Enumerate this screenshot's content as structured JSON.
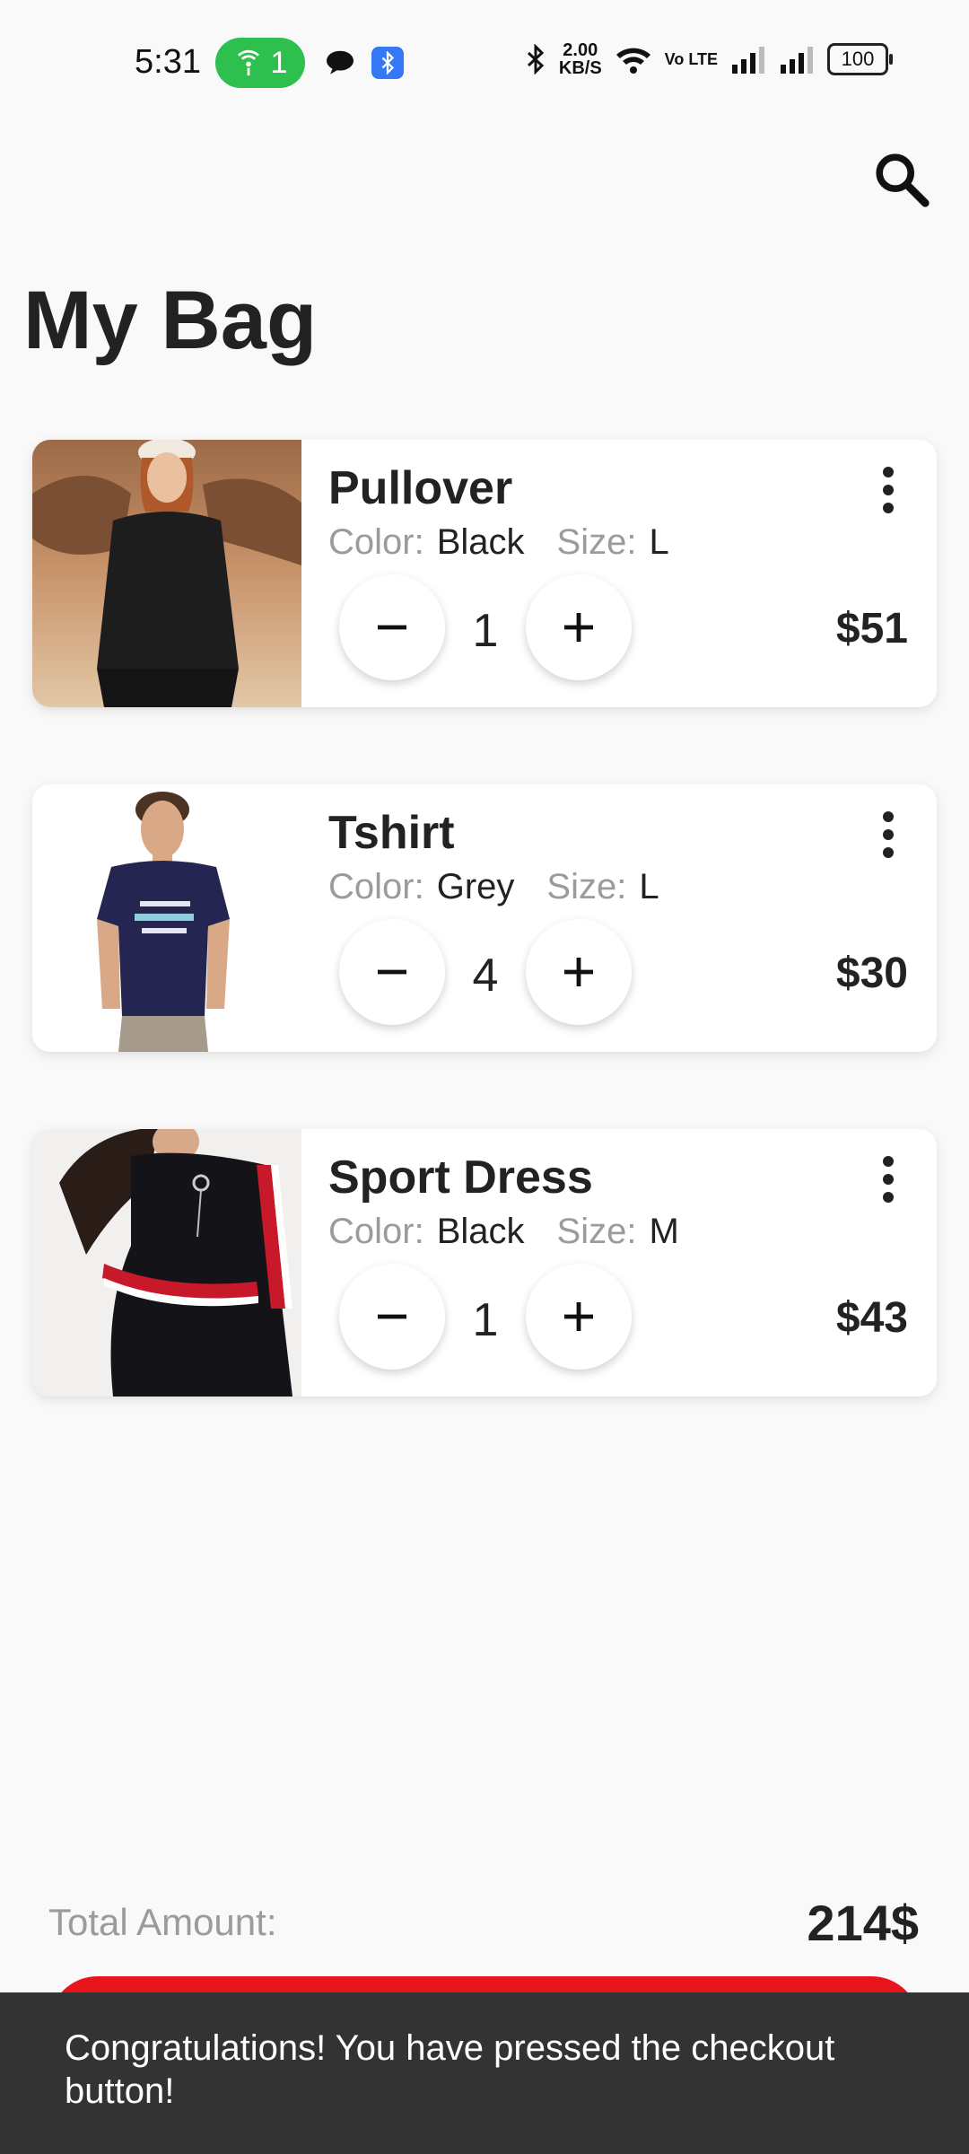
{
  "status_bar": {
    "time": "5:31",
    "hotspot_count": "1",
    "speed_value": "2.00",
    "speed_unit": "KB/S",
    "volte": "Vo LTE",
    "battery": "100"
  },
  "header": {
    "title": "My Bag"
  },
  "labels": {
    "color": "Color:",
    "size": "Size:"
  },
  "cart": {
    "items": [
      {
        "name": "Pullover",
        "color": "Black",
        "size": "L",
        "quantity": "1",
        "price": "$51"
      },
      {
        "name": "Tshirt",
        "color": "Grey",
        "size": "L",
        "quantity": "4",
        "price": "$30"
      },
      {
        "name": "Sport Dress",
        "color": "Black",
        "size": "M",
        "quantity": "1",
        "price": "$43"
      }
    ]
  },
  "footer": {
    "total_label": "Total Amount:",
    "total_value": "214$"
  },
  "snackbar": {
    "message": "Congratulations! You have pressed the checkout button!"
  },
  "colors": {
    "background": "#f9f9f9",
    "accent_red": "#e8141b",
    "snackbar_bg": "#333333",
    "hotspot_green": "#2ec04f"
  }
}
